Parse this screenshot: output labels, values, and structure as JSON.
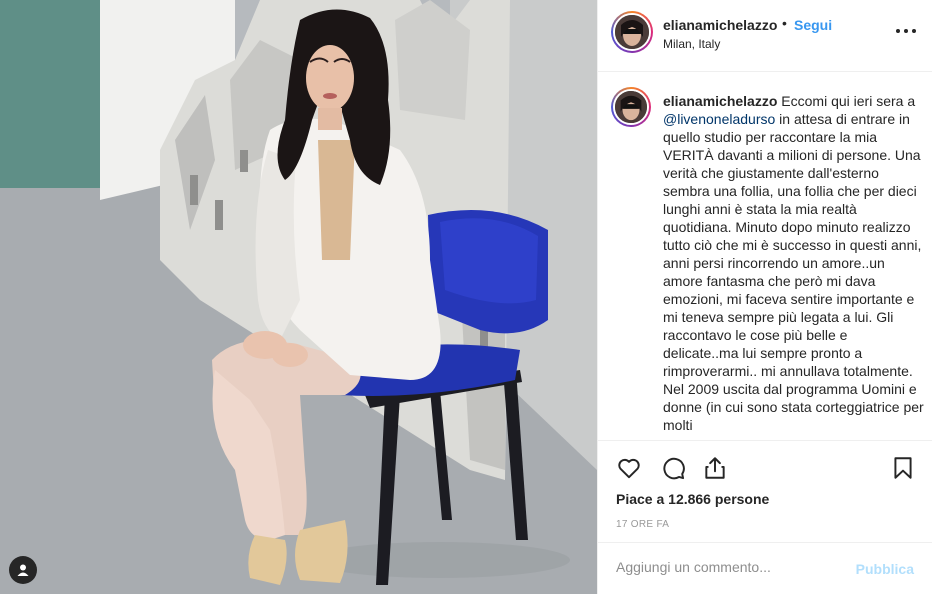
{
  "post": {
    "username": "elianamichelazzo",
    "follow_label": "Segui",
    "separator": "•",
    "location": "Milan, Italy",
    "caption_username": "elianamichelazzo",
    "caption_text_1": " Eccomi qui ieri sera a ",
    "mention": "@livenoneladurso",
    "caption_text_2": " in attesa di entrare in quello studio per raccontare la mia VERITÀ davanti a milioni di persone. Una verità che giustamente dall'esterno sembra una follia, una follia che per dieci lunghi anni è stata la mia realtà quotidiana. Minuto dopo minuto realizzo tutto ciò che mi è successo in questi anni, anni persi rincorrendo un amore..un amore fantasma che però mi dava emozioni, mi faceva sentire importante e mi teneva sempre più legata a lui. Gli raccontavo le cose più belle e delicate..ma lui sempre pronto a rimproverarmi.. mi annullava totalmente. Nel 2009 uscita dal programma Uomini e donne (in cui sono stata corteggiatrice per molti",
    "likes_text": "Piace a 12.866 persone",
    "time_ago": "17 ORE FA"
  },
  "comment": {
    "placeholder": "Aggiungi un commento...",
    "publish_label": "Pubblica"
  },
  "icons": {
    "like": "heart-icon",
    "comment": "comment-bubble-icon",
    "share": "share-icon",
    "save": "bookmark-icon",
    "more": "more-options-icon",
    "tags": "user-tag-icon"
  },
  "colors": {
    "link": "#3897f0",
    "mention": "#003569",
    "publish_disabled": "#b2dffc",
    "border": "#efefef"
  }
}
